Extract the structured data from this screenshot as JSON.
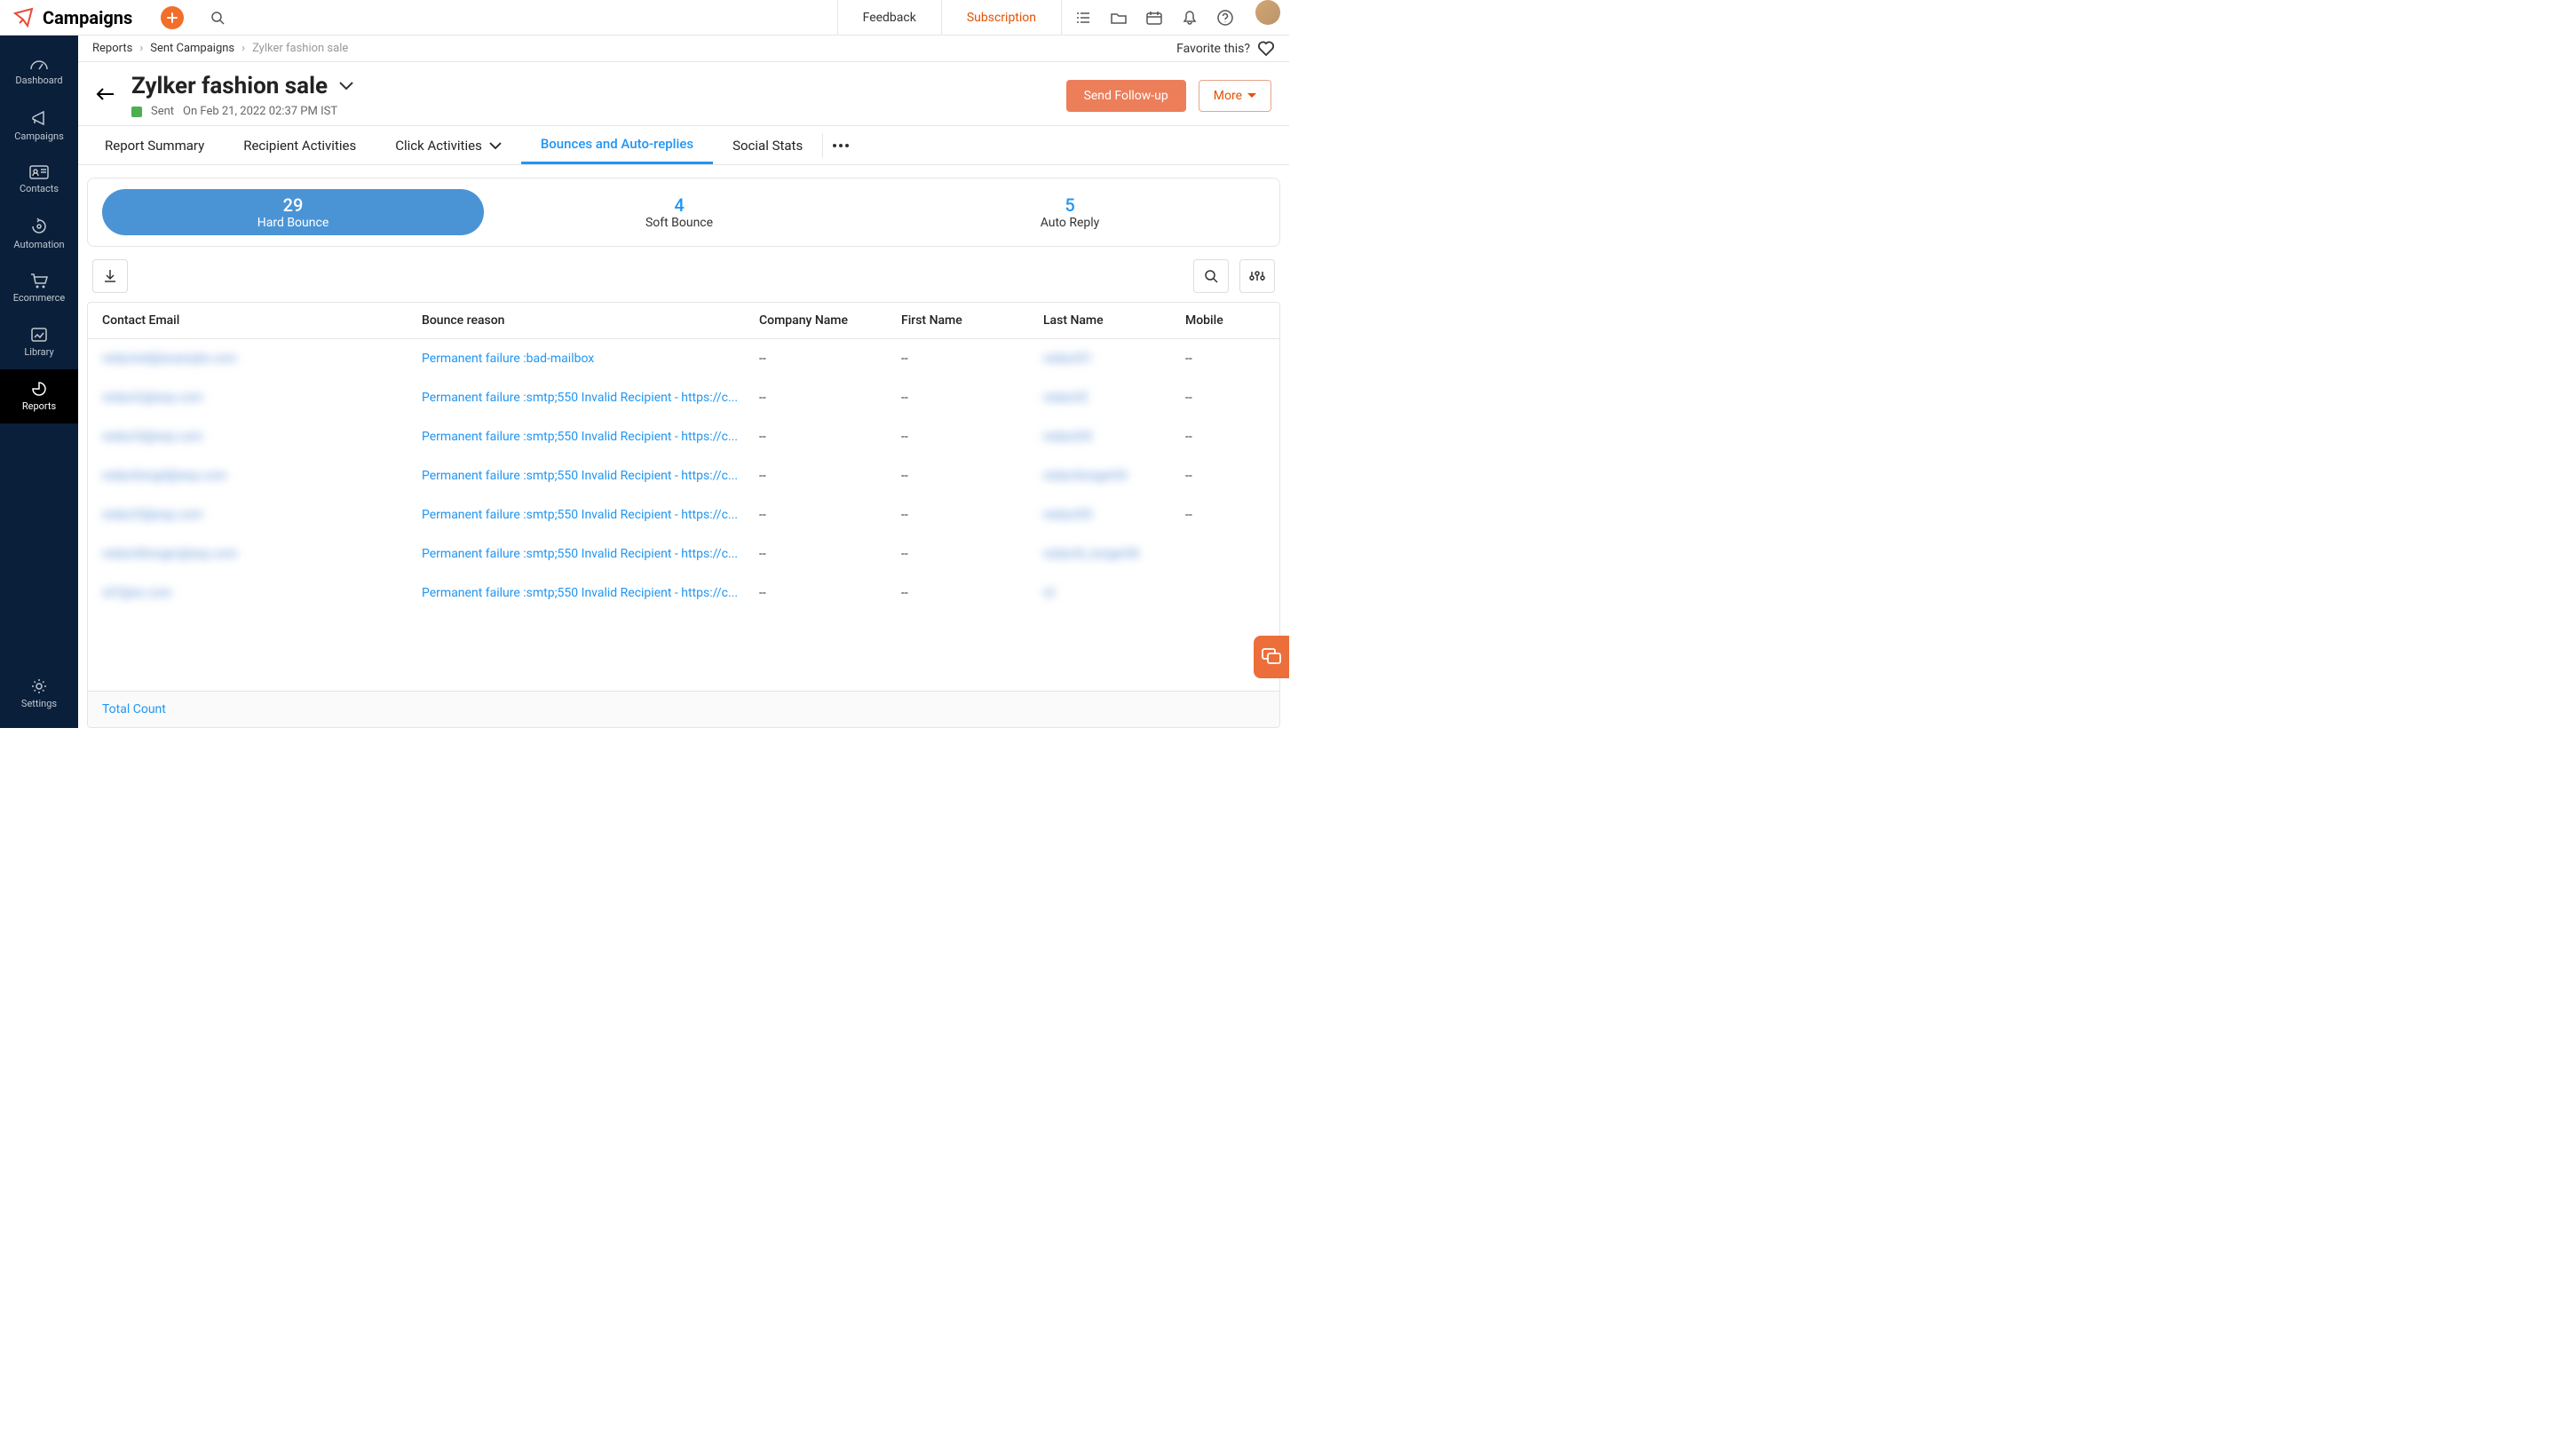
{
  "app": {
    "title": "Campaigns"
  },
  "topbar": {
    "feedback": "Feedback",
    "subscription": "Subscription"
  },
  "sidebar": {
    "items": [
      {
        "label": "Dashboard"
      },
      {
        "label": "Campaigns"
      },
      {
        "label": "Contacts"
      },
      {
        "label": "Automation"
      },
      {
        "label": "Ecommerce"
      },
      {
        "label": "Library"
      },
      {
        "label": "Reports"
      }
    ],
    "settings": "Settings"
  },
  "breadcrumb": {
    "items": [
      "Reports",
      "Sent Campaigns",
      "Zylker fashion sale"
    ],
    "favorite": "Favorite this?"
  },
  "campaign": {
    "title": "Zylker fashion sale",
    "status": "Sent",
    "sent_on": "On Feb 21, 2022 02:37 PM IST",
    "send_followup": "Send Follow-up",
    "more": "More"
  },
  "tabs": {
    "items": [
      "Report Summary",
      "Recipient Activities",
      "Click Activities",
      "Bounces and Auto-replies",
      "Social Stats"
    ]
  },
  "pills": [
    {
      "count": "29",
      "label": "Hard Bounce"
    },
    {
      "count": "4",
      "label": "Soft Bounce"
    },
    {
      "count": "5",
      "label": "Auto Reply"
    }
  ],
  "table": {
    "headers": {
      "email": "Contact Email",
      "reason": "Bounce reason",
      "company": "Company Name",
      "first": "First Name",
      "last": "Last Name",
      "mobile": "Mobile"
    },
    "rows": [
      {
        "email": "redacted@example.com",
        "reason": "Permanent failure :bad-mailbox",
        "company": "--",
        "first": "--",
        "last": "redact01",
        "mobile": "--"
      },
      {
        "email": "redact2@exp.com",
        "reason": "Permanent failure :smtp;550 Invalid Recipient - https://c...",
        "company": "--",
        "first": "--",
        "last": "redac02",
        "mobile": "--"
      },
      {
        "email": "redact3@exp.com",
        "reason": "Permanent failure :smtp;550 Invalid Recipient - https://c...",
        "company": "--",
        "first": "--",
        "last": "redact03",
        "mobile": "--"
      },
      {
        "email": "redactlong4@exp.com",
        "reason": "Permanent failure :smtp;550 Invalid Recipient - https://c...",
        "company": "--",
        "first": "--",
        "last": "redactlonger04",
        "mobile": "--"
      },
      {
        "email": "redact5@exp.com",
        "reason": "Permanent failure :smtp;550 Invalid Recipient - https://c...",
        "company": "--",
        "first": "--",
        "last": "redact05",
        "mobile": "--"
      },
      {
        "email": "redact6longer@exp.com",
        "reason": "Permanent failure :smtp;550 Invalid Recipient - https://c...",
        "company": "--",
        "first": "--",
        "last": "redact6_longer06",
        "mobile": ""
      },
      {
        "email": "rd7@ex.com",
        "reason": "Permanent failure :smtp;550 Invalid Recipient - https://c...",
        "company": "--",
        "first": "--",
        "last": "rd",
        "mobile": ""
      }
    ],
    "total_count": "Total Count"
  }
}
